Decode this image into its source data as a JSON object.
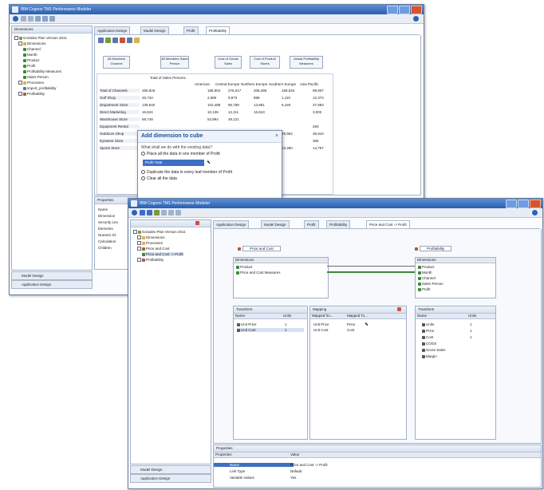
{
  "back_window": {
    "title": "IBM Cognos TM1 Performance Modeler",
    "tabs": [
      "Application Design",
      "Model Design",
      "Profit",
      "Profitability"
    ],
    "dimensions_panel": {
      "header": "Dimensions",
      "tree": [
        "GoSales Plan Version 2011",
        "Dimensions",
        "Channel",
        "Month",
        "Product",
        "Profit",
        "Profitability Measures",
        "Sales Person",
        "Processes",
        "import_profitability",
        "Profitability"
      ]
    },
    "dim_buttons": [
      "All Members Channel",
      "All Members Sales Person",
      "Cost of Goods Sales",
      "Cost of Product Stores",
      "Actual Profitability Measures"
    ],
    "grid": {
      "header": "Total of Sales Persons",
      "columns": [
        "Americas",
        "Central Europe",
        "Northern Europe",
        "Southern Europe",
        "Asia Pacific"
      ],
      "rows": [
        {
          "label": "Total of Channels",
          "values": [
            "265,926",
            "188,904",
            "276,017",
            "208,285",
            "169,534",
            "98,907"
          ]
        },
        {
          "label": "Golf Shop",
          "values": [
            "26,734",
            "2,980",
            "5,873",
            "888",
            "1,110",
            "12,374"
          ]
        },
        {
          "label": "Department Store",
          "values": [
            "139,640",
            "102,489",
            "95,789",
            "13,891",
            "6,160",
            "37,983"
          ]
        },
        {
          "label": "Direct Marketing",
          "values": [
            "16,844",
            "10,136",
            "12,111",
            "16,813",
            "",
            "3,002"
          ]
        },
        {
          "label": "Warehouse Store",
          "values": [
            "58,748",
            "53,994",
            "29,121",
            "",
            "",
            ""
          ]
        },
        {
          "label": "Equipment Rental",
          "values": [
            "",
            "",
            "",
            "",
            "",
            "250"
          ]
        },
        {
          "label": "Outdoors Shop",
          "values": [
            "",
            "",
            "",
            "",
            "29,964",
            "35,910"
          ]
        },
        {
          "label": "Eyewear Store",
          "values": [
            "",
            "",
            "",
            "",
            "",
            "365"
          ]
        },
        {
          "label": "Sports Store",
          "values": [
            "",
            "",
            "",
            "",
            "13,360",
            "14,757"
          ]
        }
      ]
    },
    "dialog": {
      "title": "Add dimension to cube",
      "question": "What shall we do with the existing data?",
      "options": [
        "Place all the data in one member of Profit",
        "Profit Total",
        "Duplicate the data in every leaf member of Profit",
        "Clear all the data"
      ],
      "selected_value": "Profit Total"
    },
    "properties": {
      "header": "Properties",
      "rows": [
        "Name",
        "Dimension",
        "Security Lev.",
        "Elements",
        "Numeric El.",
        "Calculation",
        "Children"
      ]
    },
    "bottom_tabs": [
      "Model Design",
      "Application Design"
    ]
  },
  "front_window": {
    "title": "IBM Cognos TM1 Performance Modeler",
    "tabs": [
      "Application Design",
      "Model Design",
      "Profit",
      "Profitability",
      "Price and Cost -> Profit"
    ],
    "tree": [
      "GoSales Plan Version 2011",
      "Dimensions",
      "Processes",
      "Price and Cost",
      "Price and Cost -> Profit",
      "Profitability"
    ],
    "source_cube": "Price and Cost",
    "target_cube": "Profitability",
    "source_dims_header": "Dimensions",
    "source_dims": [
      "Product",
      "Price and Cost Measures"
    ],
    "target_dims_header": "Dimensions",
    "target_dims": [
      "Product",
      "Month",
      "Channel",
      "Sales Person",
      "Profit"
    ],
    "transform_left": {
      "header": "Transform",
      "columns": [
        "Name",
        "Units"
      ],
      "rows": [
        {
          "name": "Unit Price",
          "units": "1"
        },
        {
          "name": "Unit Cost",
          "units": "1"
        }
      ]
    },
    "mapping": {
      "header": "Mapping",
      "columns": [
        "Mapped fro...",
        "Mapped To..."
      ],
      "rows": [
        {
          "from": "Unit Price",
          "to": "Price"
        },
        {
          "from": "Unit Cost",
          "to": "Cost"
        }
      ]
    },
    "transform_right": {
      "header": "Transform",
      "columns": [
        "Name",
        "Units"
      ],
      "rows": [
        {
          "name": "Units",
          "units": "1"
        },
        {
          "name": "Price",
          "units": "1"
        },
        {
          "name": "Cost",
          "units": "1"
        },
        {
          "name": "COGS",
          "units": ""
        },
        {
          "name": "Gross Sales",
          "units": ""
        },
        {
          "name": "Margin",
          "units": ""
        }
      ]
    },
    "properties": {
      "header": "Properties",
      "columns": [
        "Properties",
        "Value"
      ],
      "rows": [
        {
          "prop": "Name",
          "value": "Price and Cost -> Profit"
        },
        {
          "prop": "Link Type",
          "value": "Default"
        },
        {
          "prop": "Variable Values",
          "value": "Yes"
        }
      ]
    },
    "bottom_tabs": [
      "Model Design",
      "Application Design"
    ]
  },
  "colors": {
    "title_blue": "#2b5fb0",
    "selection": "#3d6fc4",
    "link_green": "#3a8a3a",
    "close_red": "#d5532f"
  }
}
